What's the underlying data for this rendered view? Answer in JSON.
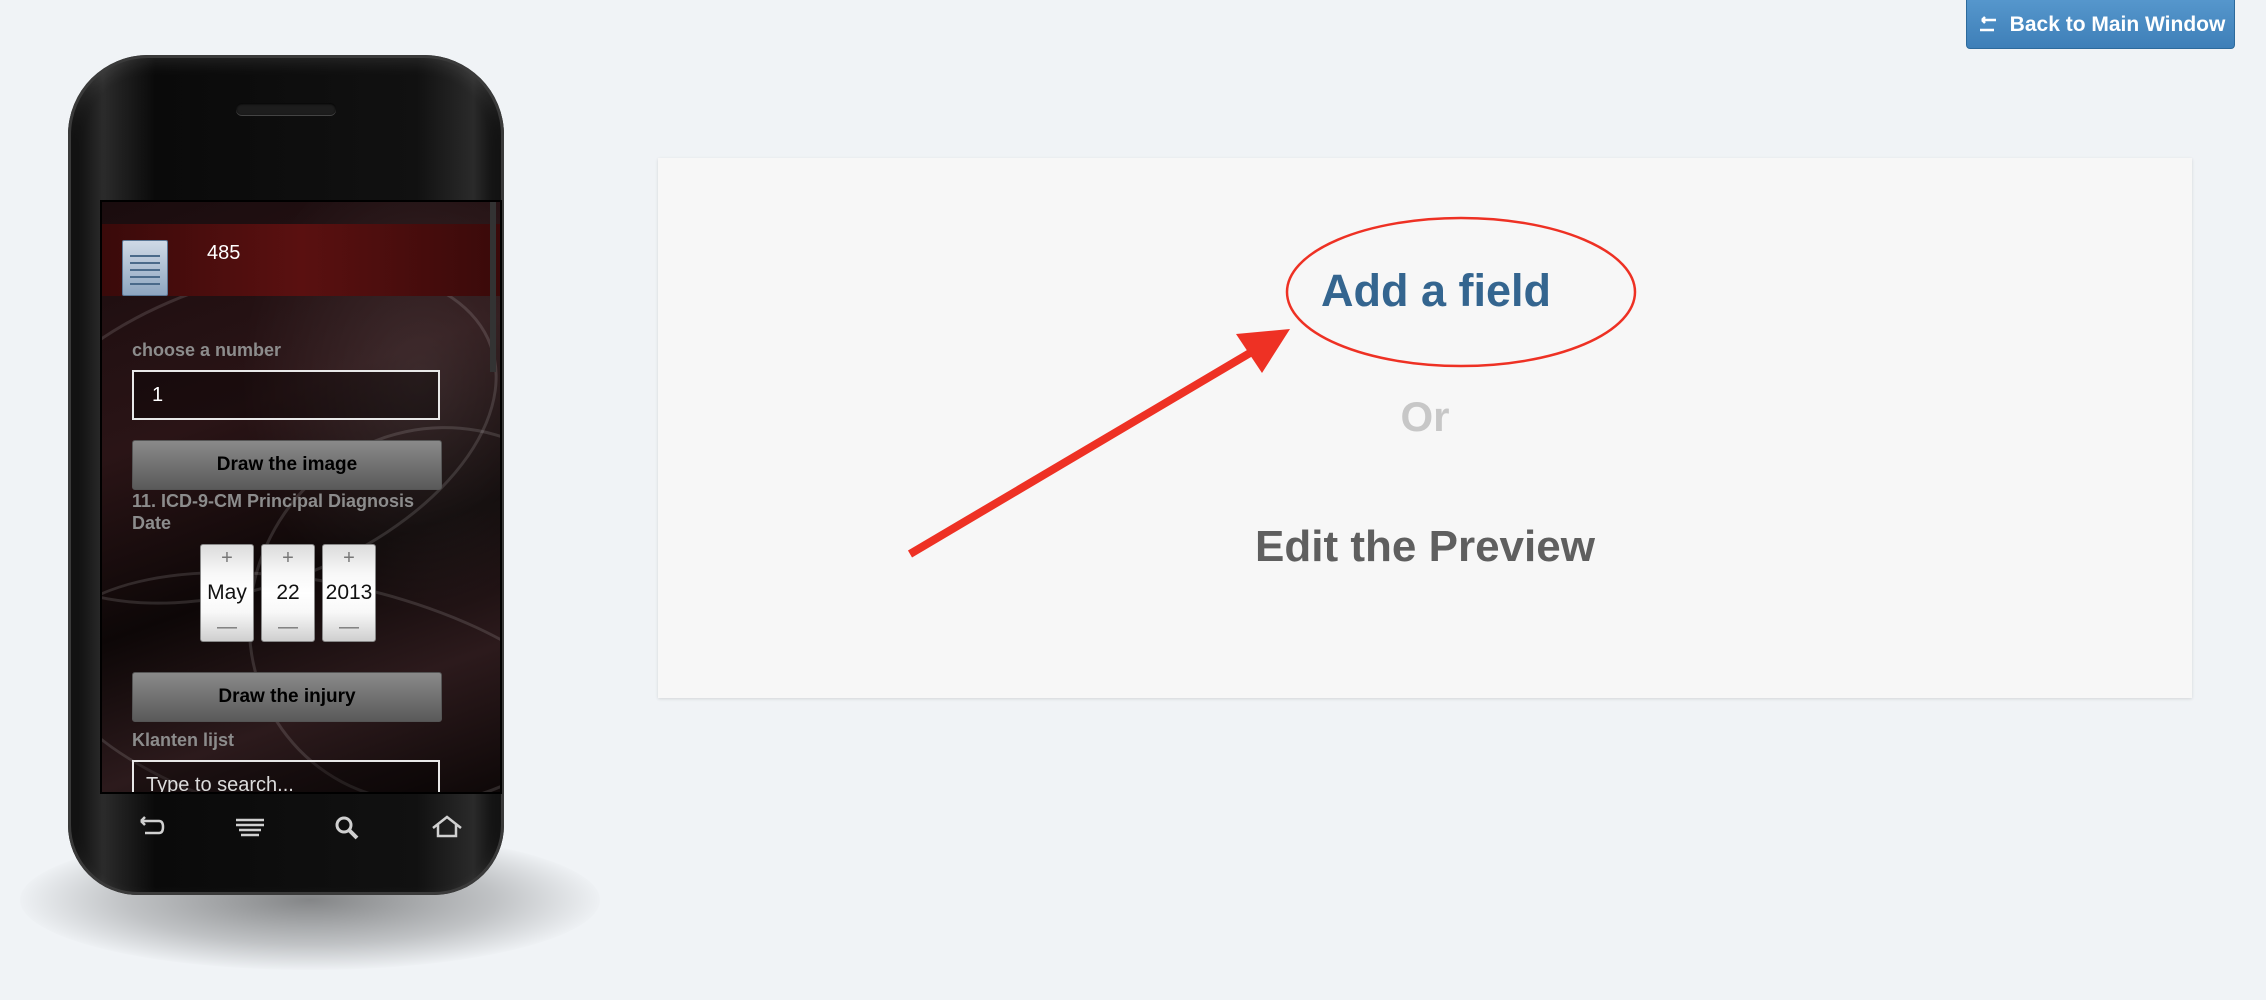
{
  "header": {
    "back_button_label": "Back to Main Window"
  },
  "main": {
    "add_field_label": "Add a field",
    "or_label": "Or",
    "edit_preview_label": "Edit the Preview"
  },
  "phone": {
    "app_title": "485",
    "choose_number_label": "choose a number",
    "choose_number_value": "1",
    "draw_image_button": "Draw the image",
    "diagnosis_date_label": "11. ICD-9-CM Principal Diagnosis Date",
    "date": {
      "month": "May",
      "day": "22",
      "year": "2013"
    },
    "stepper_plus": "+",
    "stepper_minus": "—",
    "draw_injury_button": "Draw the injury",
    "customer_list_label": "Klanten lijst",
    "search_placeholder": "Type to search..."
  },
  "nav_icons": [
    "back-icon",
    "menu-icon",
    "search-icon",
    "home-icon"
  ],
  "colors": {
    "accent": "#3e7fb8",
    "link": "#34658f",
    "annotation": "#ee3124"
  }
}
